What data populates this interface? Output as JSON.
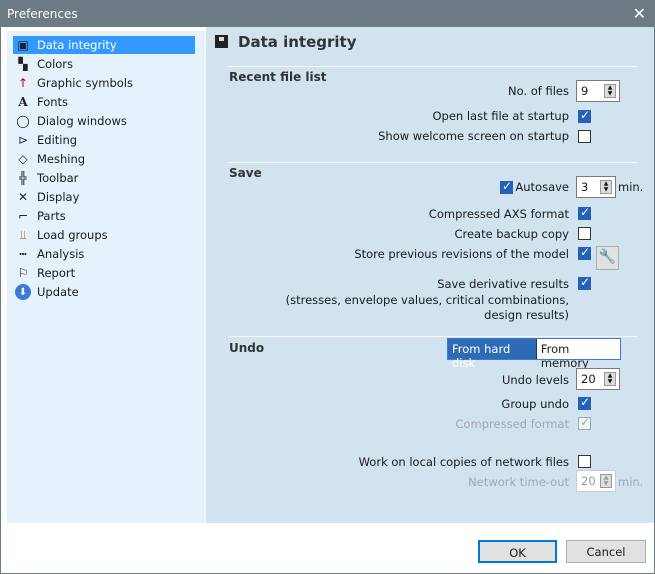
{
  "window": {
    "title": "Preferences",
    "close": "✕"
  },
  "sidebar": {
    "items": [
      {
        "label": "Data integrity",
        "icon": "floppy-disk-icon",
        "selected": true
      },
      {
        "label": "Colors",
        "icon": "colors-icon"
      },
      {
        "label": "Graphic symbols",
        "icon": "graphic-symbols-icon"
      },
      {
        "label": "Fonts",
        "icon": "font-icon"
      },
      {
        "label": "Dialog windows",
        "icon": "dialog-bubble-icon"
      },
      {
        "label": "Editing",
        "icon": "editing-icon"
      },
      {
        "label": "Meshing",
        "icon": "meshing-icon"
      },
      {
        "label": "Toolbar",
        "icon": "toolbar-icon"
      },
      {
        "label": "Display",
        "icon": "display-icon"
      },
      {
        "label": "Parts",
        "icon": "parts-icon"
      },
      {
        "label": "Load groups",
        "icon": "load-groups-icon"
      },
      {
        "label": "Analysis",
        "icon": "analysis-icon"
      },
      {
        "label": "Report",
        "icon": "report-icon"
      },
      {
        "label": "Update",
        "icon": "update-icon"
      }
    ]
  },
  "main": {
    "title": "Data integrity",
    "recent": {
      "heading": "Recent file list",
      "files_label": "No. of files",
      "files_value": "9",
      "open_last": "Open last file at startup",
      "open_last_checked": true,
      "welcome": "Show welcome screen on startup",
      "welcome_checked": false
    },
    "save": {
      "heading": "Save",
      "autosave": "Autosave",
      "autosave_checked": true,
      "autosave_value": "3",
      "unit": "min.",
      "compressed": "Compressed AXS format",
      "compressed_checked": true,
      "backup": "Create backup copy",
      "backup_checked": false,
      "revisions": "Store previous revisions of the model",
      "revisions_checked": true,
      "derivative": "Save derivative results",
      "derivative_note1": "(stresses, envelope values, critical combinations,",
      "derivative_note2": "design results)",
      "derivative_checked": true
    },
    "undo": {
      "heading": "Undo",
      "mode_disk": "From hard disk",
      "mode_memory": "From memory",
      "selected_mode": "From hard disk",
      "levels_label": "Undo levels",
      "levels_value": "20",
      "group": "Group undo",
      "group_checked": true,
      "compressed": "Compressed format",
      "compressed_checked": true,
      "local": "Work on local copies of network files",
      "local_checked": false,
      "timeout_label": "Network time-out",
      "timeout_value": "20",
      "unit": "min."
    }
  },
  "footer": {
    "ok": "OK",
    "cancel": "Cancel"
  }
}
